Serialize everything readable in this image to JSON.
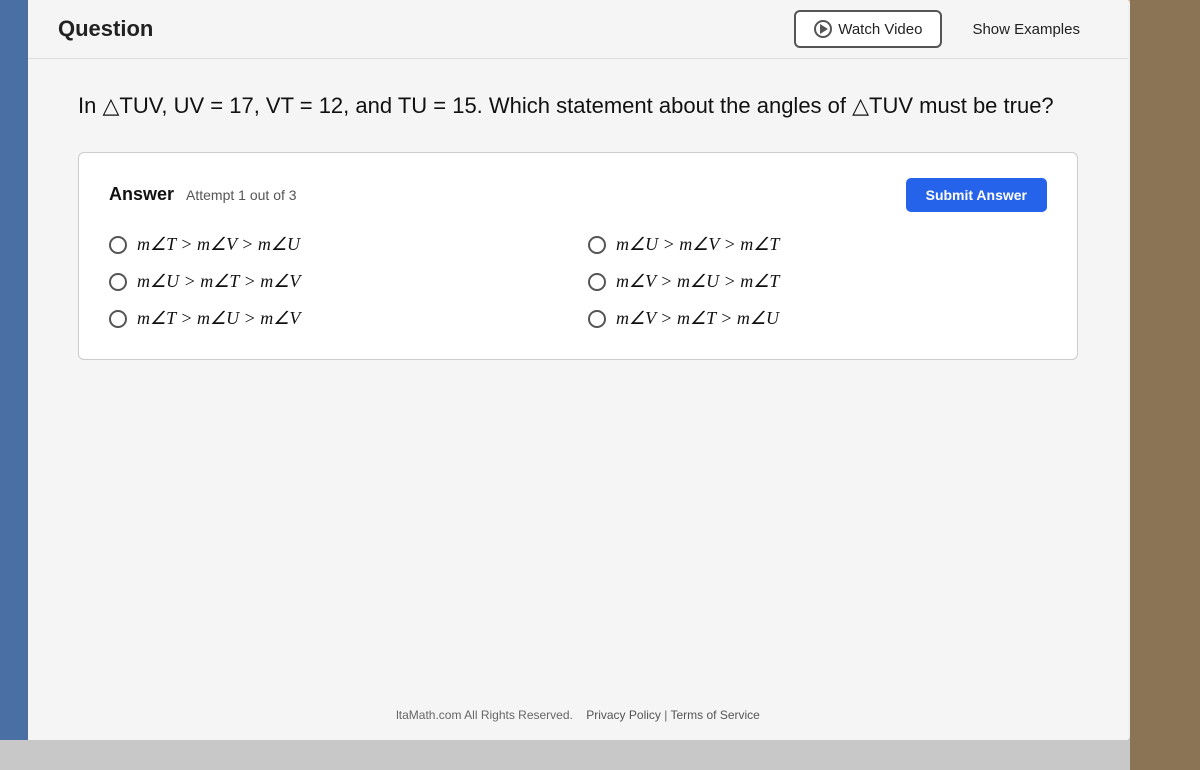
{
  "header": {
    "question_label": "Question",
    "watch_video_label": "Watch Video",
    "show_examples_label": "Show Examples"
  },
  "question": {
    "text": "In △TUV, UV = 17, VT = 12, and TU = 15. Which statement about the angles of △TUV must be true?"
  },
  "answer": {
    "label": "Answer",
    "attempt_text": "Attempt 1 out of 3",
    "submit_label": "Submit Answer",
    "options": [
      {
        "id": "opt1",
        "text": "m∠T > m∠V > m∠U"
      },
      {
        "id": "opt2",
        "text": "m∠U > m∠V > m∠T"
      },
      {
        "id": "opt3",
        "text": "m∠U > m∠T > m∠V"
      },
      {
        "id": "opt4",
        "text": "m∠V > m∠U > m∠T"
      },
      {
        "id": "opt5",
        "text": "m∠T > m∠U > m∠V"
      },
      {
        "id": "opt6",
        "text": "m∠V > m∠T > m∠U"
      }
    ]
  },
  "footer": {
    "copyright": "ltaMath.com All Rights Reserved.",
    "privacy": "Privacy Policy",
    "separator": "|",
    "terms": "Terms of Service"
  }
}
